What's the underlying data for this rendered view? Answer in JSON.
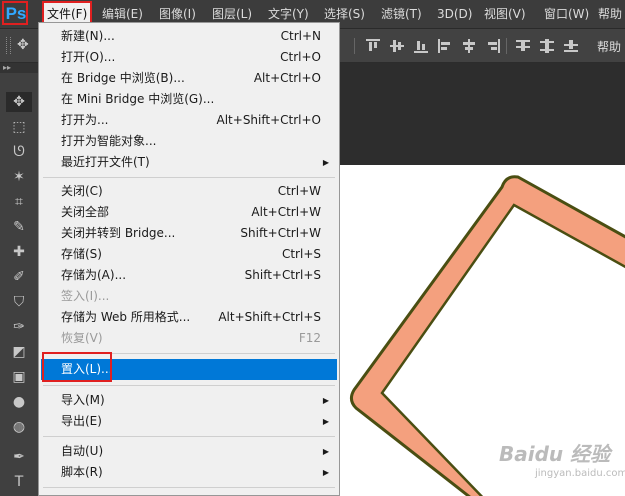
{
  "menubar": {
    "logo": "Ps",
    "items": [
      {
        "label": "文件(F)"
      },
      {
        "label": "编辑(E)"
      },
      {
        "label": "图像(I)"
      },
      {
        "label": "图层(L)"
      },
      {
        "label": "文字(Y)"
      },
      {
        "label": "选择(S)"
      },
      {
        "label": "滤镜(T)"
      },
      {
        "label": "3D(D)"
      },
      {
        "label": "视图(V)"
      },
      {
        "label": "窗口(W)"
      },
      {
        "label": "帮助"
      }
    ]
  },
  "file_menu": {
    "items": [
      {
        "label": "新建(N)...",
        "shortcut": "Ctrl+N"
      },
      {
        "label": "打开(O)...",
        "shortcut": "Ctrl+O"
      },
      {
        "label": "在 Bridge 中浏览(B)...",
        "shortcut": "Alt+Ctrl+O"
      },
      {
        "label": "在 Mini Bridge 中浏览(G)...",
        "shortcut": ""
      },
      {
        "label": "打开为...",
        "shortcut": "Alt+Shift+Ctrl+O"
      },
      {
        "label": "打开为智能对象...",
        "shortcut": ""
      },
      {
        "label": "最近打开文件(T)",
        "shortcut": "",
        "submenu": "▶"
      },
      {
        "label": "关闭(C)",
        "shortcut": "Ctrl+W"
      },
      {
        "label": "关闭全部",
        "shortcut": "Alt+Ctrl+W"
      },
      {
        "label": "关闭并转到 Bridge...",
        "shortcut": "Shift+Ctrl+W"
      },
      {
        "label": "存储(S)",
        "shortcut": "Ctrl+S"
      },
      {
        "label": "存储为(A)...",
        "shortcut": "Shift+Ctrl+S"
      },
      {
        "label": "签入(I)...",
        "shortcut": "",
        "disabled": true
      },
      {
        "label": "存储为 Web 所用格式...",
        "shortcut": "Alt+Shift+Ctrl+S"
      },
      {
        "label": "恢复(V)",
        "shortcut": "F12",
        "disabled": true
      },
      {
        "label": "置入(L)...",
        "shortcut": "",
        "highlighted": true
      },
      {
        "label": "导入(M)",
        "shortcut": "",
        "submenu": "▶"
      },
      {
        "label": "导出(E)",
        "shortcut": "",
        "submenu": "▶"
      },
      {
        "label": "自动(U)",
        "shortcut": "",
        "submenu": "▶"
      },
      {
        "label": "脚本(R)",
        "shortcut": "",
        "submenu": "▶"
      }
    ]
  },
  "options_bar": {
    "right_text": "帮助"
  },
  "tools": [
    "move-tool",
    "marquee-tool",
    "lasso-tool",
    "magic-wand-tool",
    "crop-tool",
    "eyedropper-tool",
    "healing-brush-tool",
    "brush-tool",
    "clone-stamp-tool",
    "history-brush-tool",
    "eraser-tool",
    "gradient-tool",
    "blur-tool",
    "dodge-tool",
    "pen-tool",
    "type-tool"
  ],
  "tool_glyphs": [
    "✥",
    "⬚",
    "ᘎ",
    "✶",
    "⌗",
    "✎",
    "✚",
    "✐",
    "⛉",
    "✑",
    "◩",
    "▣",
    "●",
    "◍",
    "✒",
    "T"
  ],
  "canvas": {
    "shape_fill": "#f4a07e",
    "shape_stroke": "#4a4e12"
  },
  "watermark": {
    "brand": "Baidu 经验",
    "sub": "jingyan.baidu.com"
  },
  "colors": {
    "highlight": "#0078d7",
    "annotation_red": "#e02020"
  }
}
